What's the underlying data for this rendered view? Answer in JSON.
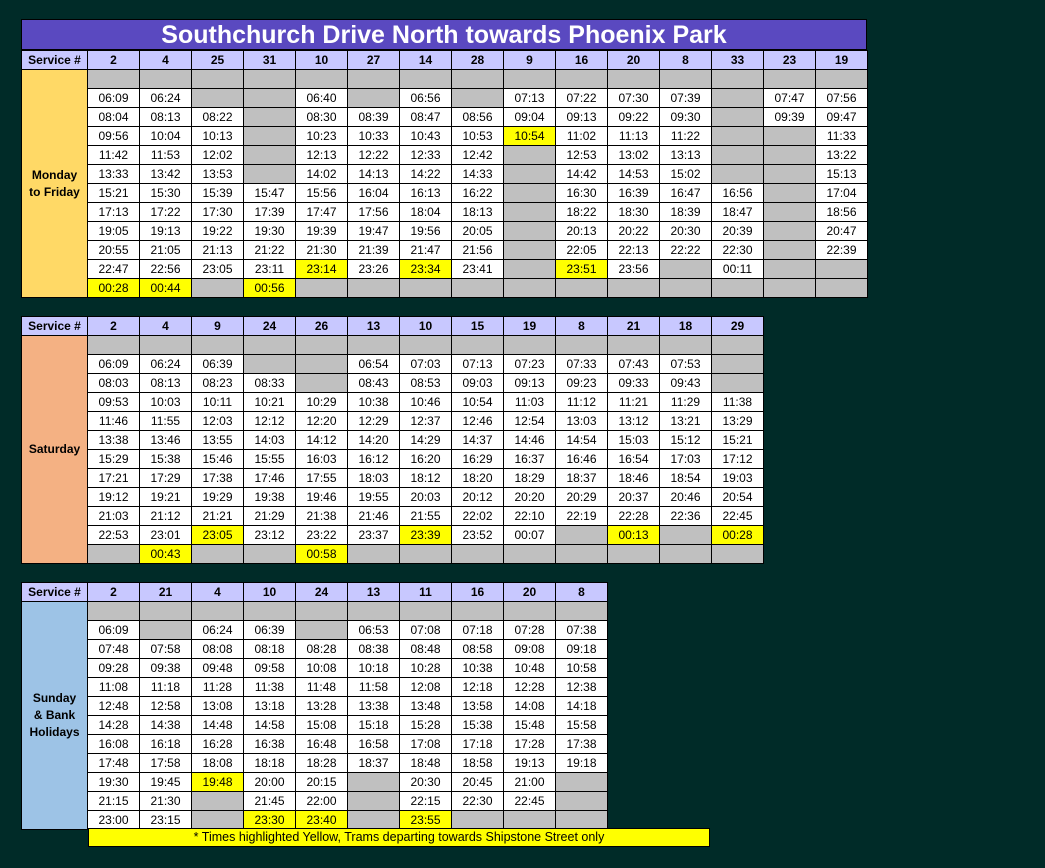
{
  "title": "Southchurch Drive North towards Phoenix Park",
  "service_label": "Service #",
  "note": "* Times highlighted Yellow, Trams departing towards Shipstone Street only",
  "colors": {
    "background": "#002b28",
    "title_bg": "#5a49c0",
    "header_bg": "#c8c8ff",
    "highlight": "#ffff00",
    "empty": "#c0c0c0",
    "weekday": "#ffd966",
    "saturday": "#f4b183",
    "sunday": "#9dc3e6"
  },
  "tables": [
    {
      "id": "weekday",
      "day_lines": [
        "Monday",
        "to Friday"
      ],
      "day_color": "#ffd966",
      "services": [
        "2",
        "4",
        "25",
        "31",
        "10",
        "27",
        "14",
        "28",
        "9",
        "16",
        "20",
        "8",
        "33",
        "23",
        "19"
      ],
      "rows": [
        [
          "",
          "",
          "",
          "",
          "",
          "",
          "",
          "",
          "",
          "",
          "",
          "",
          "",
          "",
          ""
        ],
        [
          "06:09",
          "06:24",
          "",
          "",
          "06:40",
          "",
          "06:56",
          "",
          "07:13",
          "07:22",
          "07:30",
          "07:39",
          "",
          "07:47",
          "07:56"
        ],
        [
          "08:04",
          "08:13",
          "08:22",
          "",
          "08:30",
          "08:39",
          "08:47",
          "08:56",
          "09:04",
          "09:13",
          "09:22",
          "09:30",
          "",
          "09:39",
          "09:47"
        ],
        [
          "09:56",
          "10:04",
          "10:13",
          "",
          "10:23",
          "10:33",
          "10:43",
          "10:53",
          "*10:54",
          "11:02",
          "11:13",
          "11:22",
          "",
          "",
          "11:33"
        ],
        [
          "11:42",
          "11:53",
          "12:02",
          "",
          "12:13",
          "12:22",
          "12:33",
          "12:42",
          "",
          "12:53",
          "13:02",
          "13:13",
          "",
          "",
          "13:22"
        ],
        [
          "13:33",
          "13:42",
          "13:53",
          "",
          "14:02",
          "14:13",
          "14:22",
          "14:33",
          "",
          "14:42",
          "14:53",
          "15:02",
          "",
          "",
          "15:13"
        ],
        [
          "15:21",
          "15:30",
          "15:39",
          "15:47",
          "15:56",
          "16:04",
          "16:13",
          "16:22",
          "",
          "16:30",
          "16:39",
          "16:47",
          "16:56",
          "",
          "17:04"
        ],
        [
          "17:13",
          "17:22",
          "17:30",
          "17:39",
          "17:47",
          "17:56",
          "18:04",
          "18:13",
          "",
          "18:22",
          "18:30",
          "18:39",
          "18:47",
          "",
          "18:56"
        ],
        [
          "19:05",
          "19:13",
          "19:22",
          "19:30",
          "19:39",
          "19:47",
          "19:56",
          "20:05",
          "",
          "20:13",
          "20:22",
          "20:30",
          "20:39",
          "",
          "20:47"
        ],
        [
          "20:55",
          "21:05",
          "21:13",
          "21:22",
          "21:30",
          "21:39",
          "21:47",
          "21:56",
          "",
          "22:05",
          "22:13",
          "22:22",
          "22:30",
          "",
          "22:39"
        ],
        [
          "22:47",
          "22:56",
          "23:05",
          "23:11",
          "*23:14",
          "23:26",
          "*23:34",
          "23:41",
          "",
          "*23:51",
          "23:56",
          "",
          "00:11",
          "",
          ""
        ],
        [
          "*00:28",
          "*00:44",
          "",
          "*00:56",
          "",
          "",
          "",
          "",
          "",
          "",
          "",
          "",
          "",
          "",
          ""
        ]
      ]
    },
    {
      "id": "saturday",
      "day_lines": [
        "Saturday"
      ],
      "day_color": "#f4b183",
      "services": [
        "2",
        "4",
        "9",
        "24",
        "26",
        "13",
        "10",
        "15",
        "19",
        "8",
        "21",
        "18",
        "29"
      ],
      "rows": [
        [
          "",
          "",
          "",
          "",
          "",
          "",
          "",
          "",
          "",
          "",
          "",
          "",
          ""
        ],
        [
          "06:09",
          "06:24",
          "06:39",
          "",
          "",
          "06:54",
          "07:03",
          "07:13",
          "07:23",
          "07:33",
          "07:43",
          "07:53",
          ""
        ],
        [
          "08:03",
          "08:13",
          "08:23",
          "08:33",
          "",
          "08:43",
          "08:53",
          "09:03",
          "09:13",
          "09:23",
          "09:33",
          "09:43",
          ""
        ],
        [
          "09:53",
          "10:03",
          "10:11",
          "10:21",
          "10:29",
          "10:38",
          "10:46",
          "10:54",
          "11:03",
          "11:12",
          "11:21",
          "11:29",
          "11:38"
        ],
        [
          "11:46",
          "11:55",
          "12:03",
          "12:12",
          "12:20",
          "12:29",
          "12:37",
          "12:46",
          "12:54",
          "13:03",
          "13:12",
          "13:21",
          "13:29"
        ],
        [
          "13:38",
          "13:46",
          "13:55",
          "14:03",
          "14:12",
          "14:20",
          "14:29",
          "14:37",
          "14:46",
          "14:54",
          "15:03",
          "15:12",
          "15:21"
        ],
        [
          "15:29",
          "15:38",
          "15:46",
          "15:55",
          "16:03",
          "16:12",
          "16:20",
          "16:29",
          "16:37",
          "16:46",
          "16:54",
          "17:03",
          "17:12"
        ],
        [
          "17:21",
          "17:29",
          "17:38",
          "17:46",
          "17:55",
          "18:03",
          "18:12",
          "18:20",
          "18:29",
          "18:37",
          "18:46",
          "18:54",
          "19:03"
        ],
        [
          "19:12",
          "19:21",
          "19:29",
          "19:38",
          "19:46",
          "19:55",
          "20:03",
          "20:12",
          "20:20",
          "20:29",
          "20:37",
          "20:46",
          "20:54"
        ],
        [
          "21:03",
          "21:12",
          "21:21",
          "21:29",
          "21:38",
          "21:46",
          "21:55",
          "22:02",
          "22:10",
          "22:19",
          "22:28",
          "22:36",
          "22:45"
        ],
        [
          "22:53",
          "23:01",
          "*23:05",
          "23:12",
          "23:22",
          "23:37",
          "*23:39",
          "23:52",
          "00:07",
          "",
          "*00:13",
          "",
          "*00:28"
        ],
        [
          "",
          "*00:43",
          "",
          "",
          "*00:58",
          "",
          "",
          "",
          "",
          "",
          "",
          "",
          ""
        ]
      ]
    },
    {
      "id": "sunday",
      "day_lines": [
        "Sunday",
        "& Bank",
        "Holidays"
      ],
      "day_color": "#9dc3e6",
      "services": [
        "2",
        "21",
        "4",
        "10",
        "24",
        "13",
        "11",
        "16",
        "20",
        "8"
      ],
      "rows": [
        [
          "",
          "",
          "",
          "",
          "",
          "",
          "",
          "",
          "",
          ""
        ],
        [
          "06:09",
          "",
          "06:24",
          "06:39",
          "",
          "06:53",
          "07:08",
          "07:18",
          "07:28",
          "07:38"
        ],
        [
          "07:48",
          "07:58",
          "08:08",
          "08:18",
          "08:28",
          "08:38",
          "08:48",
          "08:58",
          "09:08",
          "09:18"
        ],
        [
          "09:28",
          "09:38",
          "09:48",
          "09:58",
          "10:08",
          "10:18",
          "10:28",
          "10:38",
          "10:48",
          "10:58"
        ],
        [
          "11:08",
          "11:18",
          "11:28",
          "11:38",
          "11:48",
          "11:58",
          "12:08",
          "12:18",
          "12:28",
          "12:38"
        ],
        [
          "12:48",
          "12:58",
          "13:08",
          "13:18",
          "13:28",
          "13:38",
          "13:48",
          "13:58",
          "14:08",
          "14:18"
        ],
        [
          "14:28",
          "14:38",
          "14:48",
          "14:58",
          "15:08",
          "15:18",
          "15:28",
          "15:38",
          "15:48",
          "15:58"
        ],
        [
          "16:08",
          "16:18",
          "16:28",
          "16:38",
          "16:48",
          "16:58",
          "17:08",
          "17:18",
          "17:28",
          "17:38"
        ],
        [
          "17:48",
          "17:58",
          "18:08",
          "18:18",
          "18:28",
          "18:37",
          "18:48",
          "18:58",
          "19:13",
          "19:18"
        ],
        [
          "19:30",
          "19:45",
          "*19:48",
          "20:00",
          "20:15",
          "",
          "20:30",
          "20:45",
          "21:00",
          ""
        ],
        [
          "21:15",
          "21:30",
          "",
          "21:45",
          "22:00",
          "",
          "22:15",
          "22:30",
          "22:45",
          ""
        ],
        [
          "23:00",
          "23:15",
          "",
          "*23:30",
          "*23:40",
          "",
          "*23:55",
          "",
          "",
          ""
        ]
      ]
    }
  ]
}
